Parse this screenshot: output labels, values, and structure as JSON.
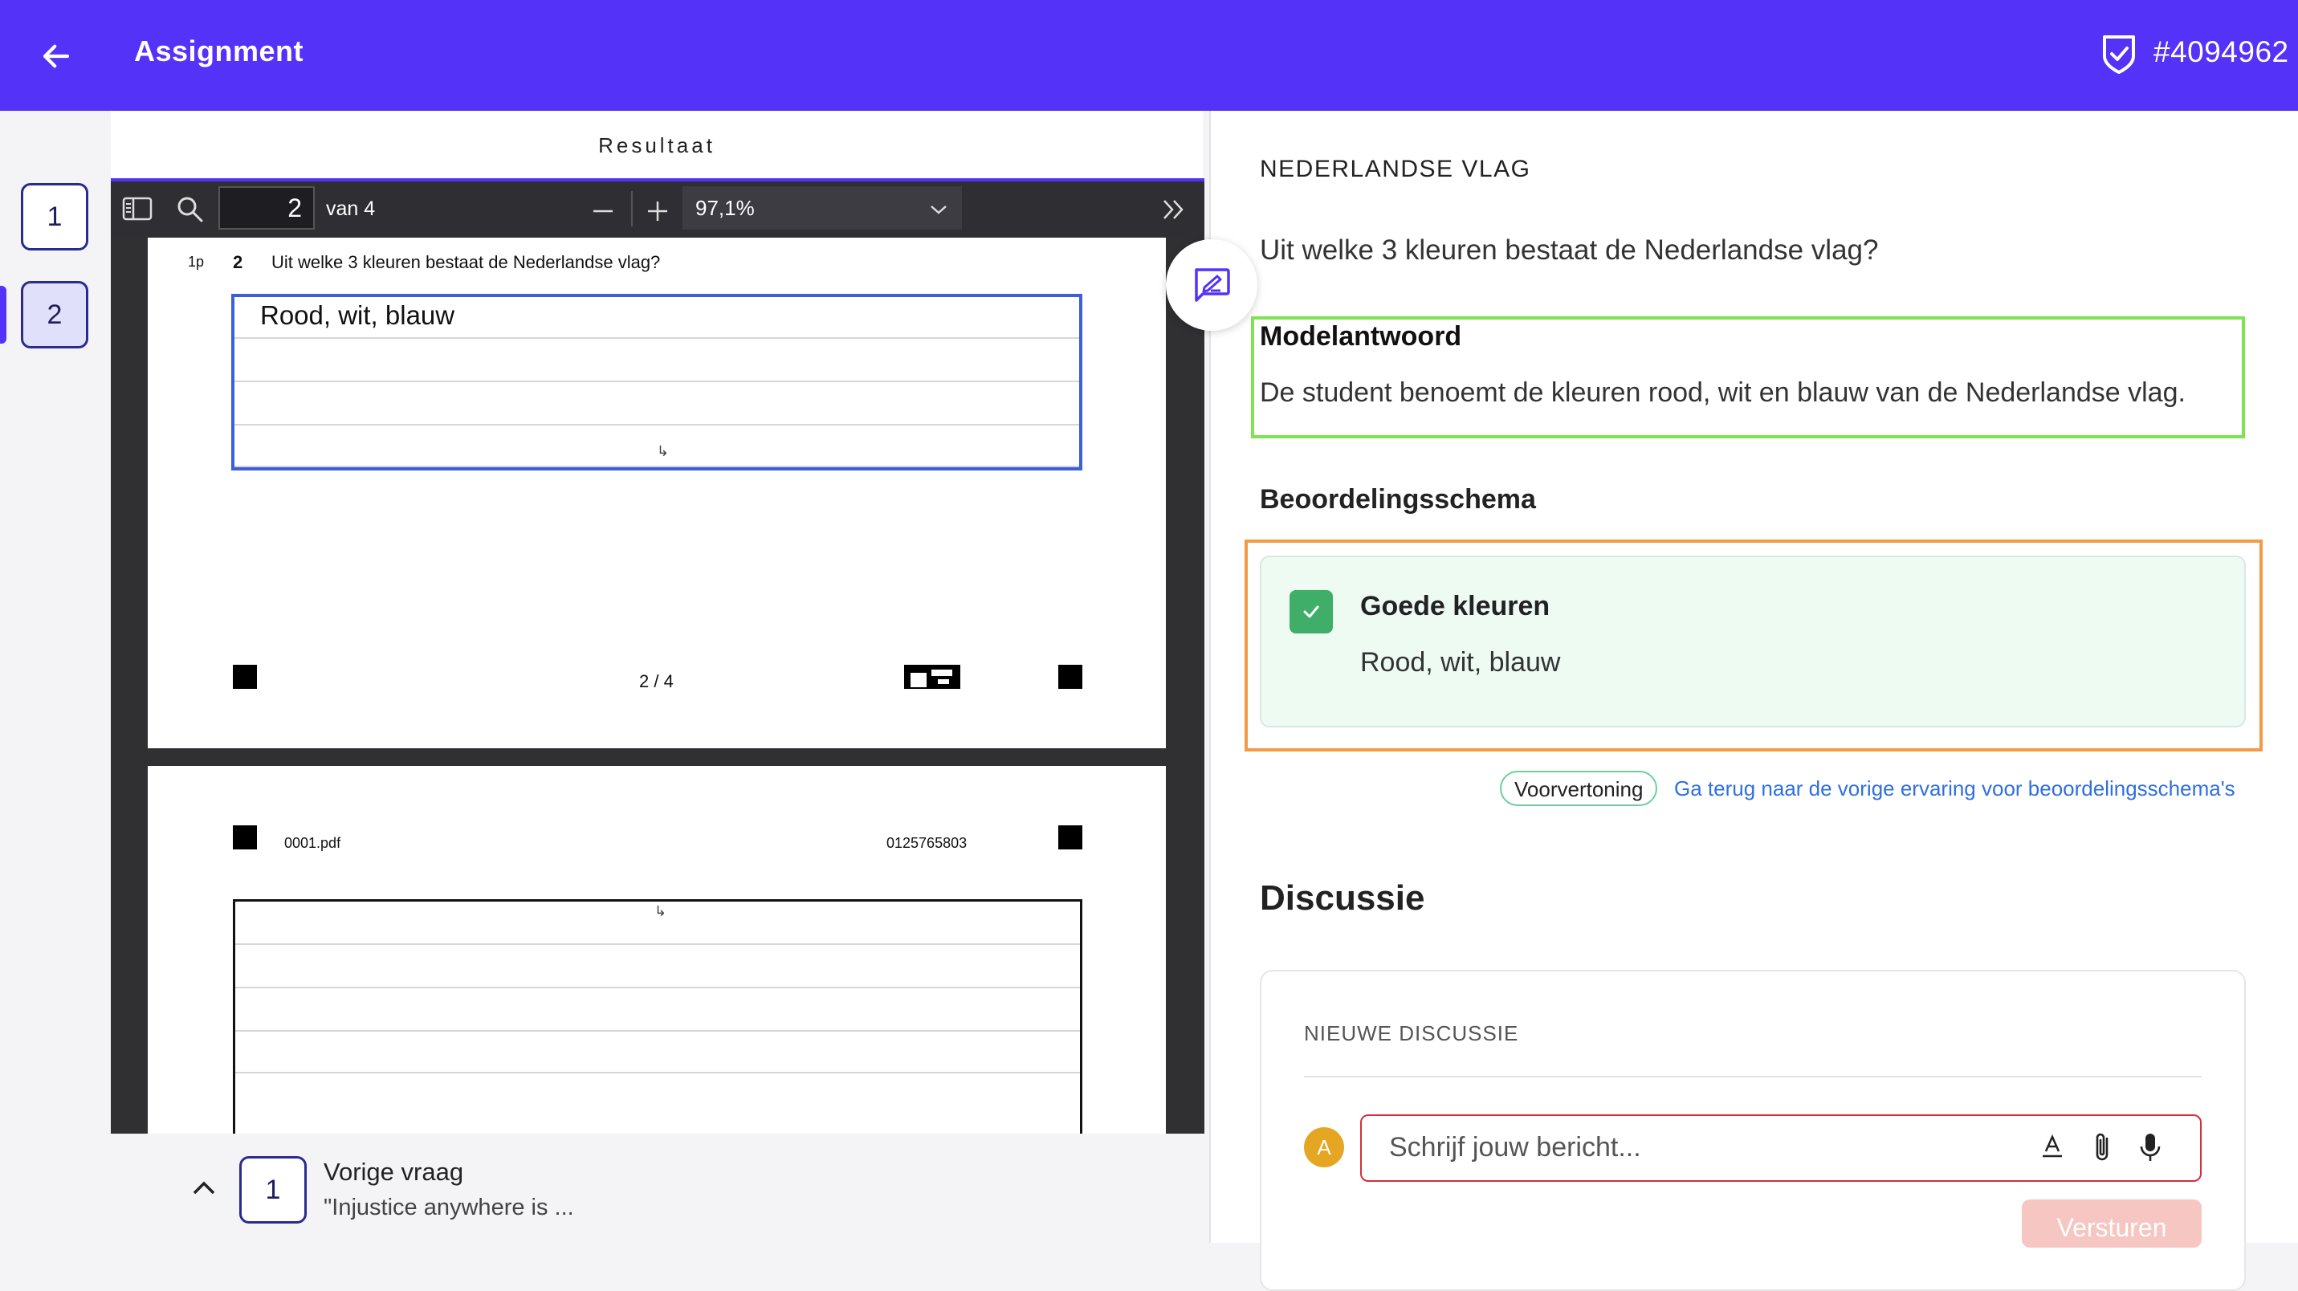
{
  "header": {
    "title": "Assignment",
    "assignment_id": "#4094962"
  },
  "question_nav": {
    "items": [
      {
        "label": "1",
        "active": false
      },
      {
        "label": "2",
        "active": true
      }
    ]
  },
  "pdf_panel": {
    "title": "Resultaat",
    "toolbar": {
      "page_current": "2",
      "page_of": "van 4",
      "zoom": "97,1%"
    },
    "page1": {
      "points": "1p",
      "question_number": "2",
      "question_text": "Uit welke 3 kleuren bestaat de Nederlandse vlag?",
      "handwritten_answer": "Rood, wit, blauw",
      "page_indicator": "2 / 4"
    },
    "page2": {
      "file_name": "0001.pdf",
      "code": "0125765803"
    }
  },
  "prev_question": {
    "number": "1",
    "label": "Vorige vraag",
    "snippet": "\"Injustice anywhere is ..."
  },
  "right_panel": {
    "question_title": "NEDERLANDSE VLAG",
    "question_text": "Uit welke 3 kleuren bestaat de Nederlandse vlag?",
    "model_answer": {
      "title": "Modelantwoord",
      "text": "De student benoemt de kleuren rood, wit en blauw van de Nederlandse vlag."
    },
    "schema": {
      "title": "Beoordelingsschema",
      "criterion_title": "Goede kleuren",
      "criterion_text": "Rood, wit, blauw",
      "checked": true
    },
    "preview_badge": "Voorvertoning",
    "back_link": "Ga terug naar de vorige ervaring voor beoordelingsschema's",
    "discussion": {
      "title": "Discussie",
      "subtitle": "NIEUWE DISCUSSIE",
      "avatar_letter": "A",
      "placeholder": "Schrijf jouw bericht...",
      "send_label": "Versturen"
    }
  },
  "colors": {
    "brand": "#5432f8",
    "model_border": "#7ee254",
    "schema_border": "#f29a45",
    "check_green": "#3fae69",
    "error_red": "#d32f3a"
  },
  "icons": [
    "back-arrow-icon",
    "shield-check-icon",
    "sidebar-toggle-icon",
    "search-icon",
    "zoom-out-icon",
    "zoom-in-icon",
    "chevron-down-icon",
    "double-chevron-right-icon",
    "annotate-icon",
    "check-icon",
    "chevron-up-icon",
    "text-format-icon",
    "paperclip-icon",
    "microphone-icon"
  ]
}
